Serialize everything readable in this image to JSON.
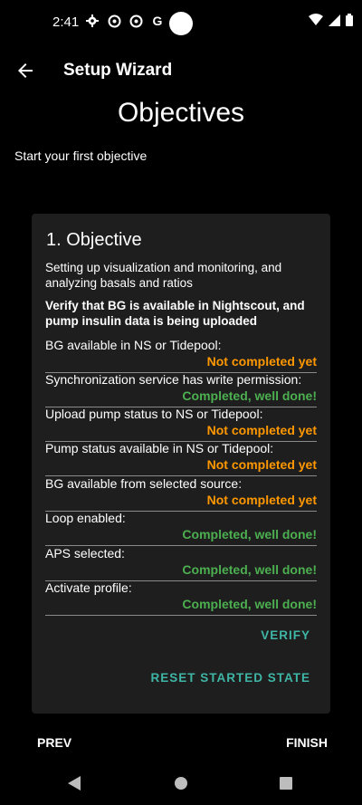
{
  "status_bar": {
    "time": "2:41",
    "left_icons": [
      "settings-icon",
      "app-icon",
      "app-icon",
      "google-icon"
    ],
    "right_icons": [
      "wifi-icon",
      "signal-icon",
      "battery-icon"
    ]
  },
  "app_bar": {
    "title": "Setup Wizard"
  },
  "page": {
    "title": "Objectives",
    "subtitle": "Start your first objective"
  },
  "objective": {
    "title": "1. Objective",
    "description": "Setting up visualization and monitoring, and analyzing basals and ratios",
    "goal": "Verify that BG is available in Nightscout, and pump insulin data is being uploaded",
    "tasks": [
      {
        "label": "BG available in NS or Tidepool:",
        "status": "Not completed yet",
        "done": false
      },
      {
        "label": "Synchronization service has write permission:",
        "status": "Completed, well done!",
        "done": true
      },
      {
        "label": "Upload pump status to NS or Tidepool:",
        "status": "Not completed yet",
        "done": false
      },
      {
        "label": "Pump status available in NS or Tidepool:",
        "status": "Not completed yet",
        "done": false
      },
      {
        "label": "BG available from selected source:",
        "status": "Not completed yet",
        "done": false
      },
      {
        "label": "Loop enabled:",
        "status": "Completed, well done!",
        "done": true
      },
      {
        "label": "APS selected:",
        "status": "Completed, well done!",
        "done": true
      },
      {
        "label": "Activate profile:",
        "status": "Completed, well done!",
        "done": true
      }
    ],
    "verify_label": "VERIFY",
    "reset_label": "RESET STARTED STATE"
  },
  "footer": {
    "prev_label": "PREV",
    "finish_label": "FINISH"
  },
  "colors": {
    "not_completed": "#ff9800",
    "completed": "#4caf50",
    "accent": "#3fb5a6",
    "card_bg": "#1e1e1e"
  }
}
